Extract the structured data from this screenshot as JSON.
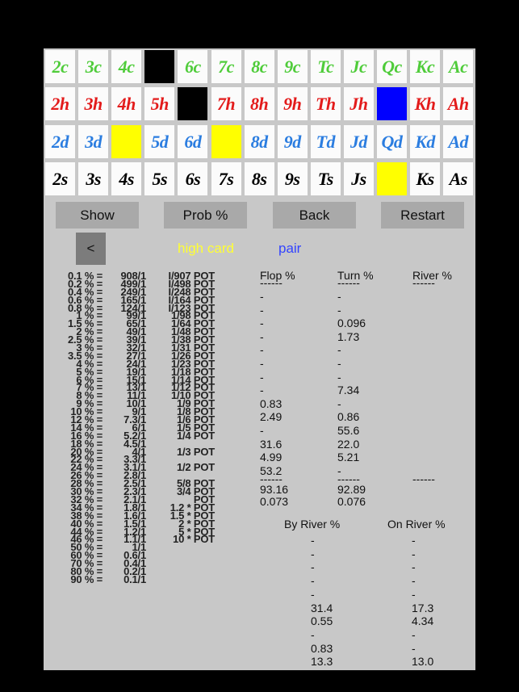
{
  "colors": {
    "clubs": "#4fcc3a",
    "hearts": "#e31b1b",
    "diamonds": "#2b7de0",
    "spades": "#000000",
    "legend_high_card": "#ffff33",
    "legend_pair": "#3344ff"
  },
  "card_grid": {
    "rows": [
      {
        "suit": "clubs",
        "cards": [
          {
            "label": "2c"
          },
          {
            "label": "3c"
          },
          {
            "label": "4c"
          },
          {
            "label": "",
            "state": "black"
          },
          {
            "label": "6c"
          },
          {
            "label": "7c"
          },
          {
            "label": "8c"
          },
          {
            "label": "9c"
          },
          {
            "label": "Tc"
          },
          {
            "label": "Jc"
          },
          {
            "label": "Qc"
          },
          {
            "label": "Kc"
          },
          {
            "label": "Ac"
          }
        ]
      },
      {
        "suit": "hearts",
        "cards": [
          {
            "label": "2h"
          },
          {
            "label": "3h"
          },
          {
            "label": "4h"
          },
          {
            "label": "5h"
          },
          {
            "label": "",
            "state": "black"
          },
          {
            "label": "7h"
          },
          {
            "label": "8h"
          },
          {
            "label": "9h"
          },
          {
            "label": "Th"
          },
          {
            "label": "Jh"
          },
          {
            "label": "",
            "state": "blue"
          },
          {
            "label": "Kh"
          },
          {
            "label": "Ah"
          }
        ]
      },
      {
        "suit": "diamonds",
        "cards": [
          {
            "label": "2d"
          },
          {
            "label": "3d"
          },
          {
            "label": "",
            "state": "yellow"
          },
          {
            "label": "5d"
          },
          {
            "label": "6d"
          },
          {
            "label": "",
            "state": "yellow"
          },
          {
            "label": "8d"
          },
          {
            "label": "9d"
          },
          {
            "label": "Td"
          },
          {
            "label": "Jd"
          },
          {
            "label": "Qd"
          },
          {
            "label": "Kd"
          },
          {
            "label": "Ad"
          }
        ]
      },
      {
        "suit": "spades",
        "cards": [
          {
            "label": "2s"
          },
          {
            "label": "3s"
          },
          {
            "label": "4s"
          },
          {
            "label": "5s"
          },
          {
            "label": "6s"
          },
          {
            "label": "7s"
          },
          {
            "label": "8s"
          },
          {
            "label": "9s"
          },
          {
            "label": "Ts"
          },
          {
            "label": "Js"
          },
          {
            "label": "",
            "state": "yellow"
          },
          {
            "label": "Ks"
          },
          {
            "label": "As"
          }
        ]
      }
    ]
  },
  "buttons": {
    "show": "Show",
    "prob": "Prob %",
    "back": "Back",
    "restart": "Restart",
    "prev": "<"
  },
  "legend": {
    "high_card": "high card",
    "pair": "pair"
  },
  "odds_table": [
    {
      "pct": "0.1 % =",
      "odds": "908/1",
      "pot": "I/907 POT"
    },
    {
      "pct": "0.2 % =",
      "odds": "499/1",
      "pot": "I/498 POT"
    },
    {
      "pct": "0.4 % =",
      "odds": "249/1",
      "pot": "I/248 POT"
    },
    {
      "pct": "0.6 % =",
      "odds": "165/1",
      "pot": "I/164 POT"
    },
    {
      "pct": "0.8 % =",
      "odds": "124/1",
      "pot": "I/123 POT"
    },
    {
      "pct": "1 % =",
      "odds": "99/1",
      "pot": "1/98 POT"
    },
    {
      "pct": "1.5 % =",
      "odds": "65/1",
      "pot": "1/64 POT"
    },
    {
      "pct": "2 % =",
      "odds": "49/1",
      "pot": "1/48 POT"
    },
    {
      "pct": "2.5 % =",
      "odds": "39/1",
      "pot": "1/38 POT"
    },
    {
      "pct": "3 % =",
      "odds": "32/1",
      "pot": "1/31 POT"
    },
    {
      "pct": "3.5 % =",
      "odds": "27/1",
      "pot": "1/26 POT"
    },
    {
      "pct": "4 % =",
      "odds": "24/1",
      "pot": "1/23 POT"
    },
    {
      "pct": "5 % =",
      "odds": "19/1",
      "pot": "1/18 POT"
    },
    {
      "pct": "6 % =",
      "odds": "15/1",
      "pot": "1/14 POT"
    },
    {
      "pct": "7 % =",
      "odds": "13/1",
      "pot": "1/12 POT"
    },
    {
      "pct": "8 % =",
      "odds": "11/1",
      "pot": "1/10 POT"
    },
    {
      "pct": "9 % =",
      "odds": "10/1",
      "pot": "1/9 POT"
    },
    {
      "pct": "10 % =",
      "odds": "9/1",
      "pot": "1/8 POT"
    },
    {
      "pct": "12 % =",
      "odds": "7.3/1",
      "pot": "1/6 POT"
    },
    {
      "pct": "14 % =",
      "odds": "6/1",
      "pot": "1/5 POT"
    },
    {
      "pct": "16 % =",
      "odds": "5.2/1",
      "pot": "1/4 POT"
    },
    {
      "pct": "18 % =",
      "odds": "4.5/1",
      "pot": ""
    },
    {
      "pct": "20 % =",
      "odds": "4/1",
      "pot": "1/3 POT"
    },
    {
      "pct": "22 % =",
      "odds": "3.3/1",
      "pot": ""
    },
    {
      "pct": "24 % =",
      "odds": "3.1/1",
      "pot": "1/2 POT"
    },
    {
      "pct": "26 % =",
      "odds": "2.8/1",
      "pot": ""
    },
    {
      "pct": "28 % =",
      "odds": "2.5/1",
      "pot": "5/8 POT"
    },
    {
      "pct": "30 % =",
      "odds": "2.3/1",
      "pot": "3/4 POT"
    },
    {
      "pct": "32 % =",
      "odds": "2.1/1",
      "pot": "POT"
    },
    {
      "pct": "34 % =",
      "odds": "1.8/1",
      "pot": "1.2 * POT"
    },
    {
      "pct": "38 % =",
      "odds": "1.6/1",
      "pot": "1.5 * POT"
    },
    {
      "pct": "40 % =",
      "odds": "1.5/1",
      "pot": "2 * POT"
    },
    {
      "pct": "44 % =",
      "odds": "1.2/1",
      "pot": "5 * POT"
    },
    {
      "pct": "46 % =",
      "odds": "1.1/1",
      "pot": "10 * POT"
    },
    {
      "pct": "50 % =",
      "odds": "1/1",
      "pot": ""
    },
    {
      "pct": "60 % =",
      "odds": "0.6/1",
      "pot": ""
    },
    {
      "pct": "70 % =",
      "odds": "0.4/1",
      "pot": ""
    },
    {
      "pct": "80 % =",
      "odds": "0.2/1",
      "pot": ""
    },
    {
      "pct": "90 % =",
      "odds": "0.1/1",
      "pot": ""
    }
  ],
  "street_stats": {
    "headers": {
      "flop": "Flop %",
      "turn": "Turn %",
      "river": "River %"
    },
    "separator": "------",
    "rows": [
      {
        "flop": "-",
        "turn": "-",
        "river": ""
      },
      {
        "flop": "-",
        "turn": "-",
        "river": ""
      },
      {
        "flop": "-",
        "turn": "0.096",
        "river": ""
      },
      {
        "flop": "-",
        "turn": "1.73",
        "river": ""
      },
      {
        "flop": "-",
        "turn": "-",
        "river": ""
      },
      {
        "flop": "-",
        "turn": "-",
        "river": ""
      },
      {
        "flop": "-",
        "turn": "-",
        "river": ""
      },
      {
        "flop": "-",
        "turn": "7.34",
        "river": ""
      },
      {
        "flop": "0.83",
        "turn": "-",
        "river": ""
      },
      {
        "flop": "2.49",
        "turn": "0.86",
        "river": ""
      },
      {
        "flop": "-",
        "turn": "55.6",
        "river": ""
      },
      {
        "flop": "31.6",
        "turn": "22.0",
        "river": ""
      },
      {
        "flop": "4.99",
        "turn": "5.21",
        "river": ""
      },
      {
        "flop": "53.2",
        "turn": "-",
        "river": ""
      }
    ],
    "totals": [
      {
        "flop": "93.16",
        "turn": "92.89",
        "river": ""
      },
      {
        "flop": "0.073",
        "turn": "0.076",
        "river": ""
      }
    ]
  },
  "river_stats": {
    "headers": {
      "by_river": "By River %",
      "on_river": "On River %"
    },
    "rows": [
      {
        "by_river": "-",
        "on_river": "-"
      },
      {
        "by_river": "-",
        "on_river": "-"
      },
      {
        "by_river": "-",
        "on_river": "-"
      },
      {
        "by_river": "-",
        "on_river": "-"
      },
      {
        "by_river": "-",
        "on_river": "-"
      },
      {
        "by_river": "31.4",
        "on_river": "17.3"
      },
      {
        "by_river": "0.55",
        "on_river": "4.34"
      },
      {
        "by_river": "-",
        "on_river": "-"
      },
      {
        "by_river": "0.83",
        "on_river": "-"
      },
      {
        "by_river": "13.3",
        "on_river": "13.0"
      }
    ]
  }
}
